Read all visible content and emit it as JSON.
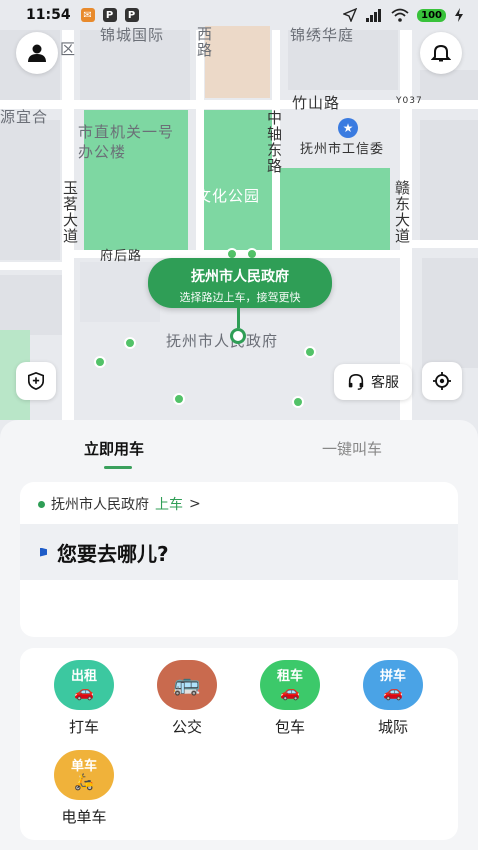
{
  "status_bar": {
    "time": "11:54",
    "app_icons": [
      "✉",
      "P",
      "P"
    ],
    "battery": "100"
  },
  "map": {
    "labels": {
      "top_district": "区",
      "jincheng": "锦城国际",
      "xi_road": "西路",
      "yiqin": "锦绣华庭",
      "zhusui": "竹山路",
      "y037": "Y037",
      "yuanyihe": "源宜合",
      "shizhiji": "市直机关一号办公楼",
      "zhongzhou": "中轴东路",
      "gongxinwei": "抚州市工信委",
      "yumingdadao": "玉茗大道",
      "wenhuagongyuan": "文化公园",
      "gandongdadao": "赣东大道",
      "fuhoulu": "府后路",
      "government": "抚州市人民政府"
    },
    "bubble": {
      "title": "抚州市人民政府",
      "subtitle": "选择路边上车，接驾更快"
    },
    "customer_service": "客服"
  },
  "tabs": {
    "active": "立即用车",
    "inactive": "一键叫车"
  },
  "pickup": {
    "place": "抚州市人民政府",
    "board": "上车",
    "arrow": ">"
  },
  "destination": {
    "prompt": "您要去哪儿?"
  },
  "services": [
    {
      "mini": "出租",
      "icon": "🚗",
      "label": "打车",
      "color": "#3cc8a0"
    },
    {
      "mini": "",
      "icon": "🚌",
      "label": "公交",
      "color": "#c96a4e"
    },
    {
      "mini": "租车",
      "icon": "🚗",
      "label": "包车",
      "color": "#3cc96a"
    },
    {
      "mini": "拼车",
      "icon": "🚗",
      "label": "城际",
      "color": "#4aa3e6"
    },
    {
      "mini": "单车",
      "icon": "🛵",
      "label": "电单车",
      "color": "#f0b23a"
    }
  ]
}
